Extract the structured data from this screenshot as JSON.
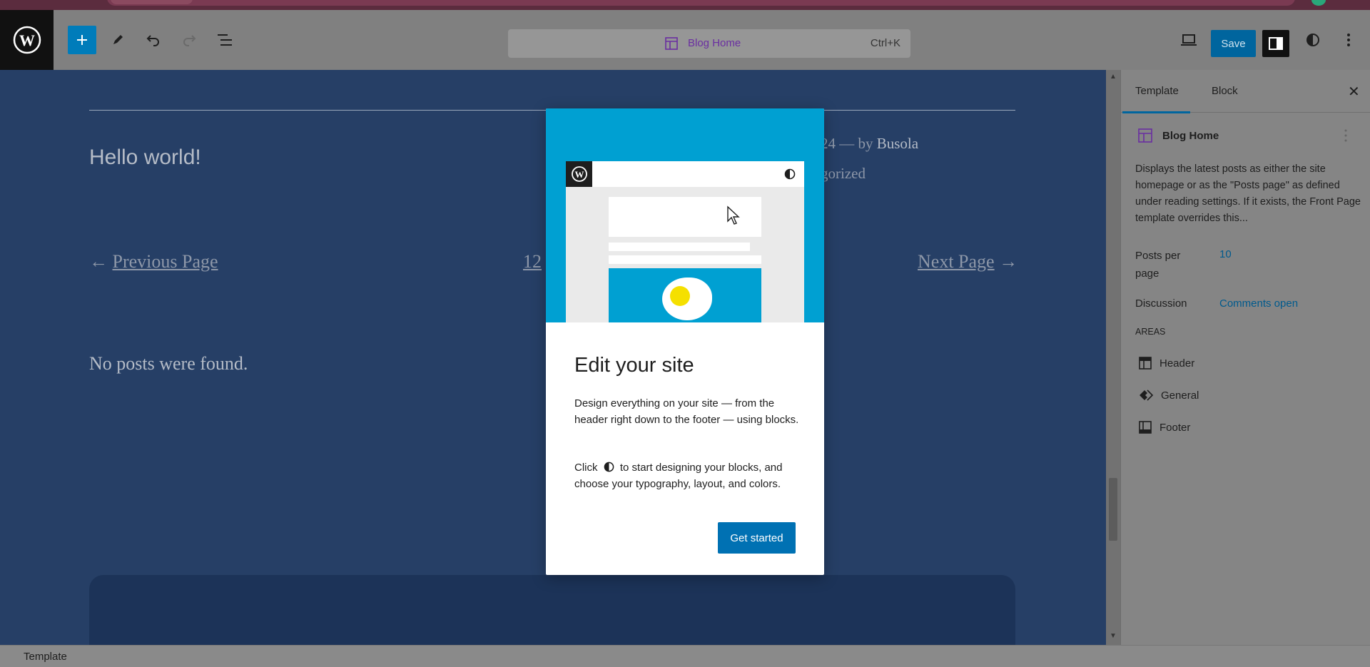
{
  "toolbar": {
    "template_title": "Blog Home",
    "shortcut": "Ctrl+K",
    "save_label": "Save"
  },
  "canvas": {
    "post_title": "Hello world!",
    "meta_line1_prefix": "24 — by ",
    "meta_author": "Busola",
    "meta_line2": "gorized",
    "previous_page": "Previous Page",
    "next_page": "Next Page",
    "page_numbers": "12",
    "no_posts": "No posts were found."
  },
  "sidebar": {
    "tabs": [
      {
        "label": "Template"
      },
      {
        "label": "Block"
      }
    ],
    "title": "Blog Home",
    "description": "Displays the latest posts as either the site homepage or as the \"Posts page\" as defined under reading settings. If it exists, the Front Page template overrides this...",
    "posts_per_page_label": "Posts per page",
    "posts_per_page_value": "10",
    "discussion_label": "Discussion",
    "discussion_value": "Comments open",
    "areas_heading": "AREAS",
    "areas": [
      {
        "label": "Header"
      },
      {
        "label": "General"
      },
      {
        "label": "Footer"
      }
    ]
  },
  "modal": {
    "title": "Edit your site",
    "paragraph1": "Design everything on your site — from the header right down to the footer — using blocks.",
    "paragraph2_before": "Click",
    "paragraph2_after": "to start designing your blocks, and choose your typography, layout, and colors.",
    "button": "Get started"
  },
  "statusbar": {
    "label": "Template"
  },
  "colors": {
    "canvas_bg": "#263f66",
    "accent": "#007cba",
    "modal_hero": "#00a0d2",
    "template_purple": "#6a2ea1"
  }
}
